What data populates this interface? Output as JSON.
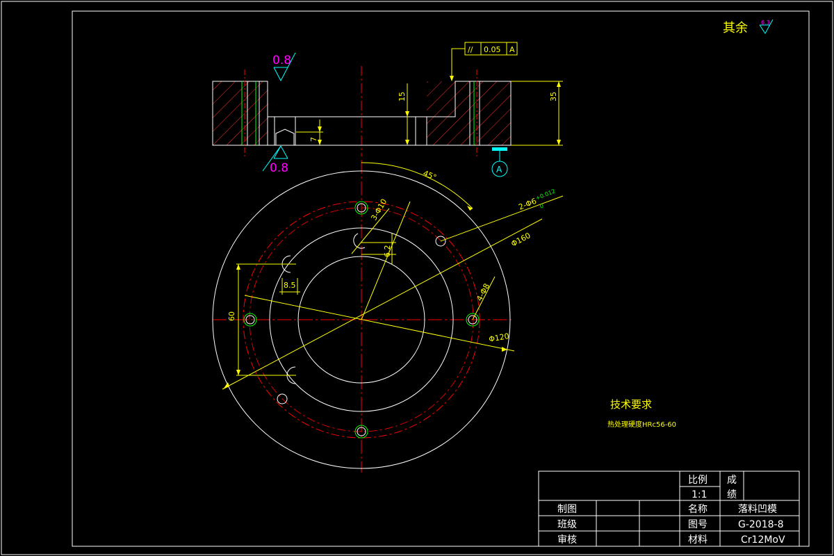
{
  "colors": {
    "background": "#000000",
    "outline": "#ffffff",
    "center_line": "#ff0000",
    "dimension": "#ffff00",
    "hatch": "#ff3030",
    "hole": "#00ffff",
    "green": "#00ff00",
    "roughness_symbol": "#ff00ff",
    "datum_mark": "#00ffff"
  },
  "roughness": {
    "top": "0.8",
    "bottom": "0.8",
    "other_label": "其余",
    "other_value": "6.3"
  },
  "geometric_tolerance": {
    "symbol": "//",
    "value": "0.05",
    "datum": "A"
  },
  "datum_label": "A",
  "section_dims": {
    "cavity_depth": "15",
    "total_height": "35",
    "step_height": "7"
  },
  "plan_dims": {
    "angle": "45°",
    "pin_holes": "2-Φ6",
    "pin_tol_upper": "+0.012",
    "pin_tol_lower": "0",
    "bolt_holes": "3-Φ10",
    "outer_dia": "Φ160",
    "offset": "6.2",
    "slot_width": "8.5",
    "slot_holes": "4-Φ8",
    "bolt_circle": "Φ120",
    "slot_span": "60"
  },
  "tech_req": {
    "title": "技术要求",
    "line1": "热处理硬度HRc56-60"
  },
  "title_block": {
    "scale_label": "比例",
    "scale_value": "1:1",
    "grade_label_1": "成",
    "grade_label_2": "绩",
    "drawn_label": "制图",
    "class_label": "班级",
    "check_label": "审核",
    "name_label": "名称",
    "name_value": "落料凹模",
    "drawing_no_label": "图号",
    "drawing_no_value": "G-2018-8",
    "material_label": "材料",
    "material_value": "Cr12MoV"
  }
}
